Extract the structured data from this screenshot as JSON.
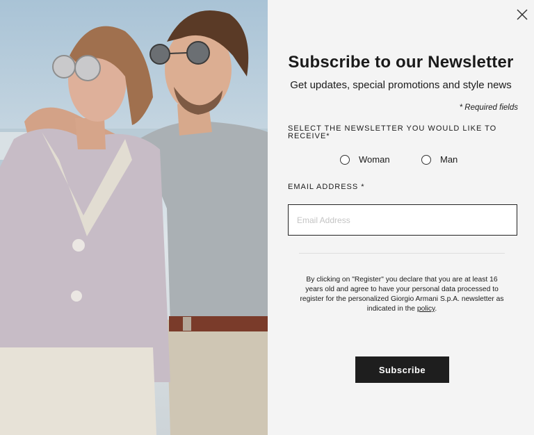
{
  "modal": {
    "title": "Subscribe to our Newsletter",
    "subtitle": "Get updates, special promotions and style news",
    "required_note": "* Required fields",
    "newsletter_label": "SELECT THE NEWSLETTER YOU WOULD LIKE TO RECEIVE*",
    "options": [
      {
        "label": "Woman",
        "selected": false
      },
      {
        "label": "Man",
        "selected": false
      }
    ],
    "email_label": "EMAIL ADDRESS *",
    "email_placeholder": "Email Address",
    "email_value": "",
    "disclaimer_text": "By clicking on \"Register\" you declare that you are at least 16 years old and agree to have your personal data processed to register for the personalized Giorgio Armani S.p.A. newsletter as indicated in the",
    "policy_link": "policy",
    "disclaimer_end": ".",
    "subscribe_label": "Subscribe"
  },
  "icons": {
    "close": "close-icon"
  },
  "colors": {
    "panel_bg": "#f4f4f4",
    "button_bg": "#1e1e1e",
    "text": "#1a1a1a"
  }
}
